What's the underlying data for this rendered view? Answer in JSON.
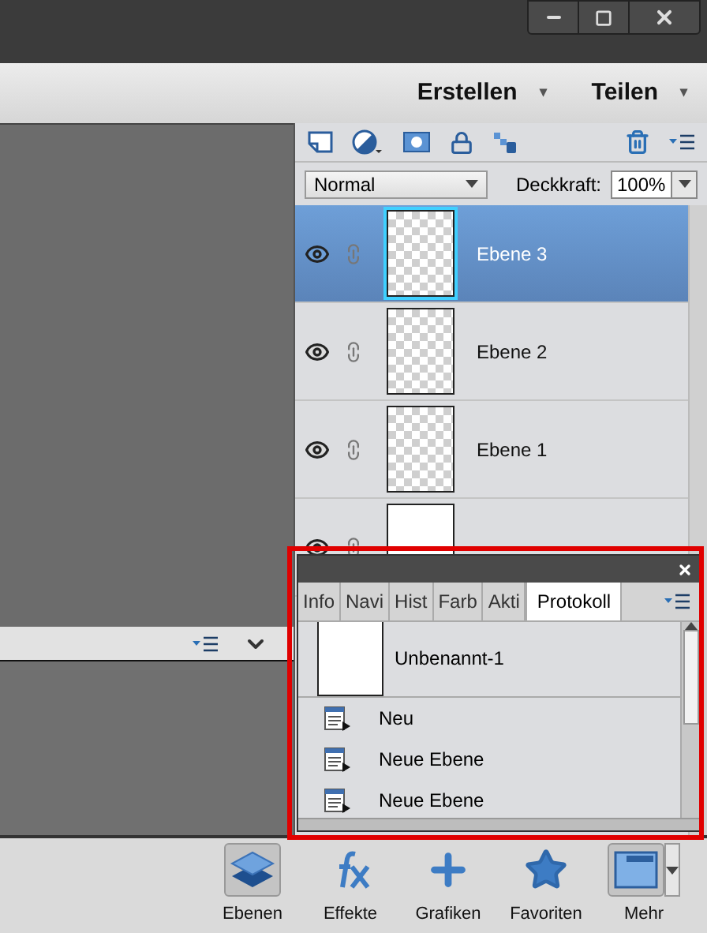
{
  "menu": [
    {
      "label": "Erstellen",
      "caret": "▾"
    },
    {
      "label": "Teilen",
      "caret": "▾"
    }
  ],
  "blend": {
    "mode": "Normal",
    "opacity_label": "Deckkraft:",
    "opacity": "100%"
  },
  "layers": [
    {
      "name": "Ebene 3",
      "selected": true,
      "transparent": true
    },
    {
      "name": "Ebene 2",
      "selected": false,
      "transparent": true
    },
    {
      "name": "Ebene 1",
      "selected": false,
      "transparent": true
    },
    {
      "selected": false,
      "transparent": false
    }
  ],
  "history_panel": {
    "tabs": [
      {
        "label": "Info",
        "selected": false
      },
      {
        "label": "Navi",
        "selected": false
      },
      {
        "label": "Hist",
        "selected": false
      },
      {
        "label": "Farb",
        "selected": false
      },
      {
        "label": "Akti",
        "selected": false
      },
      {
        "label": "Protokoll",
        "selected": true
      }
    ],
    "snapshot": "Unbenannt-1",
    "steps": [
      "Neu",
      "Neue Ebene",
      "Neue Ebene"
    ]
  },
  "bottom_buttons": [
    {
      "label": "Ebenen",
      "selected": true
    },
    {
      "label": "Effekte",
      "selected": false
    },
    {
      "label": "Grafiken",
      "selected": false
    },
    {
      "label": "Favoriten",
      "selected": false
    },
    {
      "label": "Mehr",
      "selected": true,
      "kind": "split"
    }
  ]
}
